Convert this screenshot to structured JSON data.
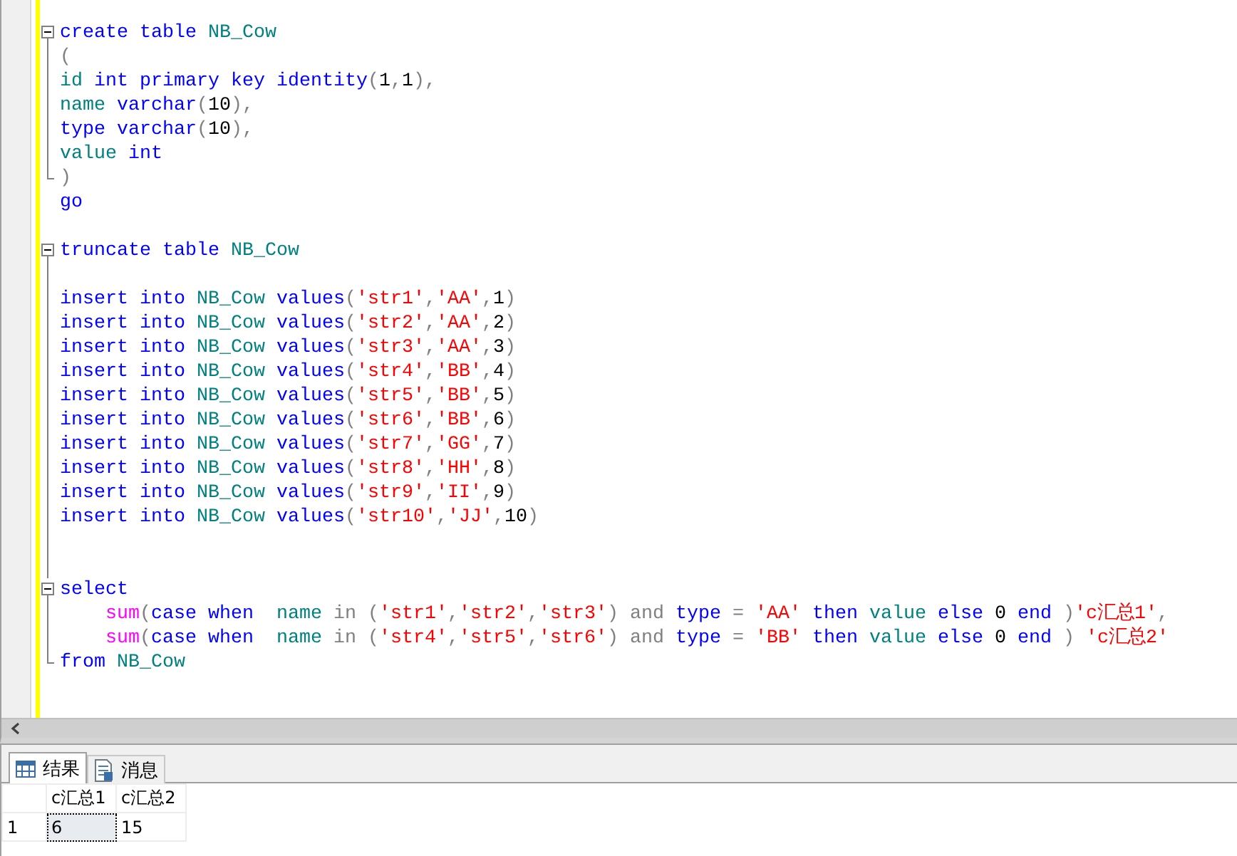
{
  "editor": {
    "lines": [
      {
        "kind": "open",
        "tokens": [
          {
            "kind": "keyword",
            "text": "create table "
          },
          {
            "kind": "ident",
            "text": "NB_Cow"
          }
        ]
      },
      {
        "kind": "body",
        "tokens": [
          {
            "kind": "punct",
            "text": "("
          }
        ]
      },
      {
        "kind": "body",
        "tokens": [
          {
            "kind": "ident",
            "text": "id "
          },
          {
            "kind": "keyword",
            "text": "int primary key identity"
          },
          {
            "kind": "punct",
            "text": "("
          },
          {
            "kind": "number",
            "text": "1"
          },
          {
            "kind": "punct",
            "text": ","
          },
          {
            "kind": "number",
            "text": "1"
          },
          {
            "kind": "punct",
            "text": "),"
          }
        ]
      },
      {
        "kind": "body",
        "tokens": [
          {
            "kind": "ident",
            "text": "name "
          },
          {
            "kind": "keyword",
            "text": "varchar"
          },
          {
            "kind": "punct",
            "text": "("
          },
          {
            "kind": "number",
            "text": "10"
          },
          {
            "kind": "punct",
            "text": "),"
          }
        ]
      },
      {
        "kind": "body",
        "tokens": [
          {
            "kind": "keyword",
            "text": "type varchar"
          },
          {
            "kind": "punct",
            "text": "("
          },
          {
            "kind": "number",
            "text": "10"
          },
          {
            "kind": "punct",
            "text": "),"
          }
        ]
      },
      {
        "kind": "body",
        "tokens": [
          {
            "kind": "ident",
            "text": "value "
          },
          {
            "kind": "keyword",
            "text": "int"
          }
        ]
      },
      {
        "kind": "end",
        "tokens": [
          {
            "kind": "punct",
            "text": ")"
          }
        ]
      },
      {
        "kind": "plain",
        "tokens": [
          {
            "kind": "keyword",
            "text": "go"
          }
        ]
      },
      {
        "kind": "plain"
      },
      {
        "kind": "open",
        "tokens": [
          {
            "kind": "keyword",
            "text": "truncate table "
          },
          {
            "kind": "ident",
            "text": "NB_Cow"
          }
        ]
      },
      {
        "kind": "body"
      },
      {
        "kind": "body",
        "tokens": [
          {
            "kind": "keyword",
            "text": "insert into "
          },
          {
            "kind": "ident",
            "text": "NB_Cow "
          },
          {
            "kind": "keyword",
            "text": "values"
          },
          {
            "kind": "punct",
            "text": "("
          },
          {
            "kind": "string",
            "text": "'str1'"
          },
          {
            "kind": "punct",
            "text": ","
          },
          {
            "kind": "string",
            "text": "'AA'"
          },
          {
            "kind": "punct",
            "text": ","
          },
          {
            "kind": "number",
            "text": "1"
          },
          {
            "kind": "punct",
            "text": ")"
          }
        ]
      },
      {
        "kind": "body",
        "tokens": [
          {
            "kind": "keyword",
            "text": "insert into "
          },
          {
            "kind": "ident",
            "text": "NB_Cow "
          },
          {
            "kind": "keyword",
            "text": "values"
          },
          {
            "kind": "punct",
            "text": "("
          },
          {
            "kind": "string",
            "text": "'str2'"
          },
          {
            "kind": "punct",
            "text": ","
          },
          {
            "kind": "string",
            "text": "'AA'"
          },
          {
            "kind": "punct",
            "text": ","
          },
          {
            "kind": "number",
            "text": "2"
          },
          {
            "kind": "punct",
            "text": ")"
          }
        ]
      },
      {
        "kind": "body",
        "tokens": [
          {
            "kind": "keyword",
            "text": "insert into "
          },
          {
            "kind": "ident",
            "text": "NB_Cow "
          },
          {
            "kind": "keyword",
            "text": "values"
          },
          {
            "kind": "punct",
            "text": "("
          },
          {
            "kind": "string",
            "text": "'str3'"
          },
          {
            "kind": "punct",
            "text": ","
          },
          {
            "kind": "string",
            "text": "'AA'"
          },
          {
            "kind": "punct",
            "text": ","
          },
          {
            "kind": "number",
            "text": "3"
          },
          {
            "kind": "punct",
            "text": ")"
          }
        ]
      },
      {
        "kind": "body",
        "tokens": [
          {
            "kind": "keyword",
            "text": "insert into "
          },
          {
            "kind": "ident",
            "text": "NB_Cow "
          },
          {
            "kind": "keyword",
            "text": "values"
          },
          {
            "kind": "punct",
            "text": "("
          },
          {
            "kind": "string",
            "text": "'str4'"
          },
          {
            "kind": "punct",
            "text": ","
          },
          {
            "kind": "string",
            "text": "'BB'"
          },
          {
            "kind": "punct",
            "text": ","
          },
          {
            "kind": "number",
            "text": "4"
          },
          {
            "kind": "punct",
            "text": ")"
          }
        ]
      },
      {
        "kind": "body",
        "tokens": [
          {
            "kind": "keyword",
            "text": "insert into "
          },
          {
            "kind": "ident",
            "text": "NB_Cow "
          },
          {
            "kind": "keyword",
            "text": "values"
          },
          {
            "kind": "punct",
            "text": "("
          },
          {
            "kind": "string",
            "text": "'str5'"
          },
          {
            "kind": "punct",
            "text": ","
          },
          {
            "kind": "string",
            "text": "'BB'"
          },
          {
            "kind": "punct",
            "text": ","
          },
          {
            "kind": "number",
            "text": "5"
          },
          {
            "kind": "punct",
            "text": ")"
          }
        ]
      },
      {
        "kind": "body",
        "tokens": [
          {
            "kind": "keyword",
            "text": "insert into "
          },
          {
            "kind": "ident",
            "text": "NB_Cow "
          },
          {
            "kind": "keyword",
            "text": "values"
          },
          {
            "kind": "punct",
            "text": "("
          },
          {
            "kind": "string",
            "text": "'str6'"
          },
          {
            "kind": "punct",
            "text": ","
          },
          {
            "kind": "string",
            "text": "'BB'"
          },
          {
            "kind": "punct",
            "text": ","
          },
          {
            "kind": "number",
            "text": "6"
          },
          {
            "kind": "punct",
            "text": ")"
          }
        ]
      },
      {
        "kind": "body",
        "tokens": [
          {
            "kind": "keyword",
            "text": "insert into "
          },
          {
            "kind": "ident",
            "text": "NB_Cow "
          },
          {
            "kind": "keyword",
            "text": "values"
          },
          {
            "kind": "punct",
            "text": "("
          },
          {
            "kind": "string",
            "text": "'str7'"
          },
          {
            "kind": "punct",
            "text": ","
          },
          {
            "kind": "string",
            "text": "'GG'"
          },
          {
            "kind": "punct",
            "text": ","
          },
          {
            "kind": "number",
            "text": "7"
          },
          {
            "kind": "punct",
            "text": ")"
          }
        ]
      },
      {
        "kind": "body",
        "tokens": [
          {
            "kind": "keyword",
            "text": "insert into "
          },
          {
            "kind": "ident",
            "text": "NB_Cow "
          },
          {
            "kind": "keyword",
            "text": "values"
          },
          {
            "kind": "punct",
            "text": "("
          },
          {
            "kind": "string",
            "text": "'str8'"
          },
          {
            "kind": "punct",
            "text": ","
          },
          {
            "kind": "string",
            "text": "'HH'"
          },
          {
            "kind": "punct",
            "text": ","
          },
          {
            "kind": "number",
            "text": "8"
          },
          {
            "kind": "punct",
            "text": ")"
          }
        ]
      },
      {
        "kind": "body",
        "tokens": [
          {
            "kind": "keyword",
            "text": "insert into "
          },
          {
            "kind": "ident",
            "text": "NB_Cow "
          },
          {
            "kind": "keyword",
            "text": "values"
          },
          {
            "kind": "punct",
            "text": "("
          },
          {
            "kind": "string",
            "text": "'str9'"
          },
          {
            "kind": "punct",
            "text": ","
          },
          {
            "kind": "string",
            "text": "'II'"
          },
          {
            "kind": "punct",
            "text": ","
          },
          {
            "kind": "number",
            "text": "9"
          },
          {
            "kind": "punct",
            "text": ")"
          }
        ]
      },
      {
        "kind": "body",
        "tokens": [
          {
            "kind": "keyword",
            "text": "insert into "
          },
          {
            "kind": "ident",
            "text": "NB_Cow "
          },
          {
            "kind": "keyword",
            "text": "values"
          },
          {
            "kind": "punct",
            "text": "("
          },
          {
            "kind": "string",
            "text": "'str10'"
          },
          {
            "kind": "punct",
            "text": ","
          },
          {
            "kind": "string",
            "text": "'JJ'"
          },
          {
            "kind": "punct",
            "text": ","
          },
          {
            "kind": "number",
            "text": "10"
          },
          {
            "kind": "punct",
            "text": ")"
          }
        ]
      },
      {
        "kind": "body"
      },
      {
        "kind": "body"
      },
      {
        "kind": "open",
        "tokens": [
          {
            "kind": "keyword",
            "text": "select"
          }
        ]
      },
      {
        "kind": "body",
        "tokens": [
          {
            "kind": "func",
            "text": "    sum"
          },
          {
            "kind": "punct",
            "text": "("
          },
          {
            "kind": "keyword",
            "text": "case when  "
          },
          {
            "kind": "ident",
            "text": "name "
          },
          {
            "kind": "operator",
            "text": "in ("
          },
          {
            "kind": "string",
            "text": "'str1'"
          },
          {
            "kind": "punct",
            "text": ","
          },
          {
            "kind": "string",
            "text": "'str2'"
          },
          {
            "kind": "punct",
            "text": ","
          },
          {
            "kind": "string",
            "text": "'str3'"
          },
          {
            "kind": "operator",
            "text": ") and "
          },
          {
            "kind": "keyword",
            "text": "type "
          },
          {
            "kind": "operator",
            "text": "= "
          },
          {
            "kind": "string",
            "text": "'AA' "
          },
          {
            "kind": "keyword",
            "text": "then "
          },
          {
            "kind": "ident",
            "text": "value "
          },
          {
            "kind": "keyword",
            "text": "else "
          },
          {
            "kind": "number",
            "text": "0 "
          },
          {
            "kind": "keyword",
            "text": "end "
          },
          {
            "kind": "punct",
            "text": ")"
          },
          {
            "kind": "string",
            "text": "'c汇总1'"
          },
          {
            "kind": "punct",
            "text": ","
          }
        ]
      },
      {
        "kind": "body",
        "tokens": [
          {
            "kind": "func",
            "text": "    sum"
          },
          {
            "kind": "punct",
            "text": "("
          },
          {
            "kind": "keyword",
            "text": "case when  "
          },
          {
            "kind": "ident",
            "text": "name "
          },
          {
            "kind": "operator",
            "text": "in ("
          },
          {
            "kind": "string",
            "text": "'str4'"
          },
          {
            "kind": "punct",
            "text": ","
          },
          {
            "kind": "string",
            "text": "'str5'"
          },
          {
            "kind": "punct",
            "text": ","
          },
          {
            "kind": "string",
            "text": "'str6'"
          },
          {
            "kind": "operator",
            "text": ") and "
          },
          {
            "kind": "keyword",
            "text": "type "
          },
          {
            "kind": "operator",
            "text": "= "
          },
          {
            "kind": "string",
            "text": "'BB' "
          },
          {
            "kind": "keyword",
            "text": "then "
          },
          {
            "kind": "ident",
            "text": "value "
          },
          {
            "kind": "keyword",
            "text": "else "
          },
          {
            "kind": "number",
            "text": "0 "
          },
          {
            "kind": "keyword",
            "text": "end "
          },
          {
            "kind": "punct",
            "text": ") "
          },
          {
            "kind": "string",
            "text": "'c汇总2'"
          }
        ]
      },
      {
        "kind": "end",
        "tokens": [
          {
            "kind": "keyword",
            "text": "from "
          },
          {
            "kind": "ident",
            "text": "NB_Cow"
          }
        ]
      }
    ]
  },
  "results": {
    "tabs": [
      {
        "label": "结果",
        "kind": "grid",
        "selected": true
      },
      {
        "label": "消息",
        "kind": "messages",
        "selected": false
      }
    ],
    "columns": [
      "c汇总1",
      "c汇总2"
    ],
    "rows": [
      {
        "number": "1",
        "cells": [
          {
            "text": "6",
            "selected": true
          },
          {
            "text": "15",
            "selected": false
          }
        ]
      }
    ]
  }
}
